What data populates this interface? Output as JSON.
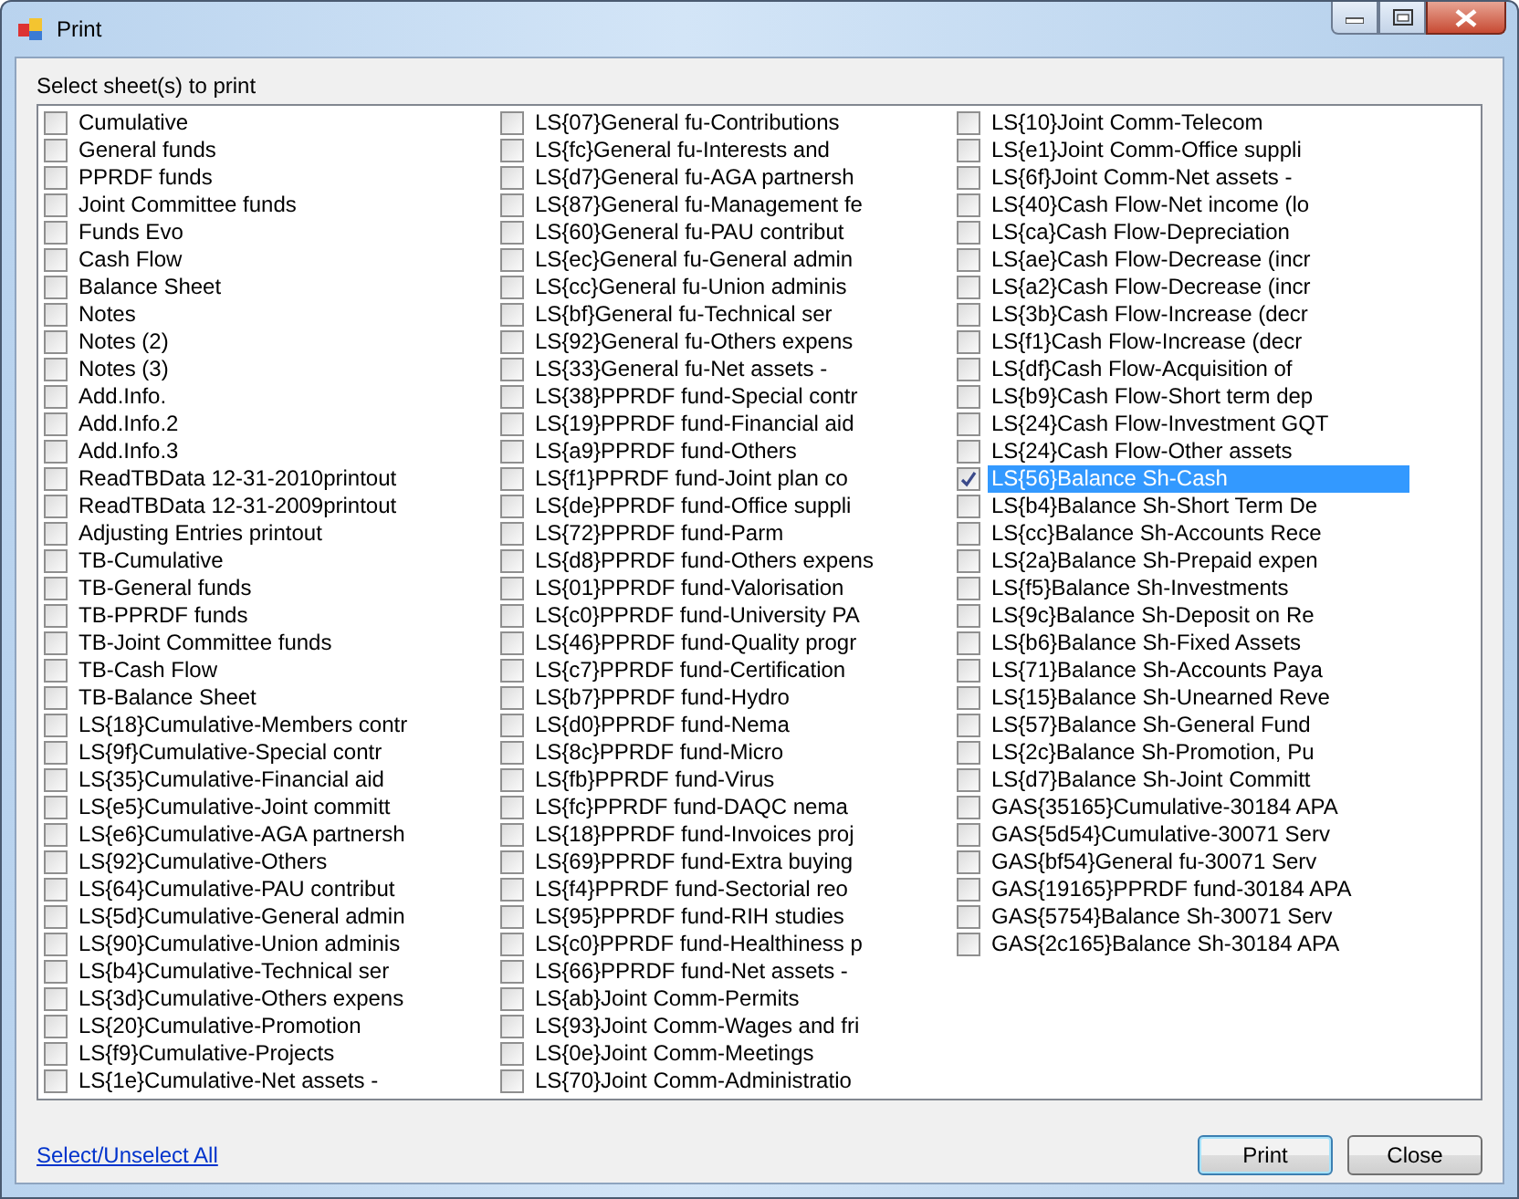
{
  "window": {
    "title": "Print"
  },
  "prompt": "Select sheet(s) to print",
  "sheets": [
    {
      "label": "Cumulative",
      "checked": false,
      "selected": false
    },
    {
      "label": "General funds",
      "checked": false,
      "selected": false
    },
    {
      "label": "PPRDF funds",
      "checked": false,
      "selected": false
    },
    {
      "label": "Joint Committee funds",
      "checked": false,
      "selected": false
    },
    {
      "label": "Funds Evo",
      "checked": false,
      "selected": false
    },
    {
      "label": "Cash Flow",
      "checked": false,
      "selected": false
    },
    {
      "label": "Balance Sheet",
      "checked": false,
      "selected": false
    },
    {
      "label": "Notes",
      "checked": false,
      "selected": false
    },
    {
      "label": "Notes (2)",
      "checked": false,
      "selected": false
    },
    {
      "label": "Notes (3)",
      "checked": false,
      "selected": false
    },
    {
      "label": "Add.Info.",
      "checked": false,
      "selected": false
    },
    {
      "label": "Add.Info.2",
      "checked": false,
      "selected": false
    },
    {
      "label": "Add.Info.3",
      "checked": false,
      "selected": false
    },
    {
      "label": "ReadTBData 12-31-2010printout",
      "checked": false,
      "selected": false
    },
    {
      "label": "ReadTBData 12-31-2009printout",
      "checked": false,
      "selected": false
    },
    {
      "label": "Adjusting Entries printout",
      "checked": false,
      "selected": false
    },
    {
      "label": "TB-Cumulative",
      "checked": false,
      "selected": false
    },
    {
      "label": "TB-General funds",
      "checked": false,
      "selected": false
    },
    {
      "label": "TB-PPRDF funds",
      "checked": false,
      "selected": false
    },
    {
      "label": "TB-Joint Committee funds",
      "checked": false,
      "selected": false
    },
    {
      "label": "TB-Cash Flow",
      "checked": false,
      "selected": false
    },
    {
      "label": "TB-Balance Sheet",
      "checked": false,
      "selected": false
    },
    {
      "label": "LS{18}Cumulative-Members contr",
      "checked": false,
      "selected": false
    },
    {
      "label": "LS{9f}Cumulative-Special contr",
      "checked": false,
      "selected": false
    },
    {
      "label": "LS{35}Cumulative-Financial aid",
      "checked": false,
      "selected": false
    },
    {
      "label": "LS{e5}Cumulative-Joint committ",
      "checked": false,
      "selected": false
    },
    {
      "label": "LS{e6}Cumulative-AGA partnersh",
      "checked": false,
      "selected": false
    },
    {
      "label": "LS{92}Cumulative-Others",
      "checked": false,
      "selected": false
    },
    {
      "label": "LS{64}Cumulative-PAU contribut",
      "checked": false,
      "selected": false
    },
    {
      "label": "LS{5d}Cumulative-General admin",
      "checked": false,
      "selected": false
    },
    {
      "label": "LS{90}Cumulative-Union adminis",
      "checked": false,
      "selected": false
    },
    {
      "label": "LS{b4}Cumulative-Technical ser",
      "checked": false,
      "selected": false
    },
    {
      "label": "LS{3d}Cumulative-Others expens",
      "checked": false,
      "selected": false
    },
    {
      "label": "LS{20}Cumulative-Promotion",
      "checked": false,
      "selected": false
    },
    {
      "label": "LS{f9}Cumulative-Projects",
      "checked": false,
      "selected": false
    },
    {
      "label": "LS{1e}Cumulative-Net assets -",
      "checked": false,
      "selected": false
    },
    {
      "label": "LS{07}General fu-Contributions",
      "checked": false,
      "selected": false
    },
    {
      "label": "LS{fc}General fu-Interests and",
      "checked": false,
      "selected": false
    },
    {
      "label": "LS{d7}General fu-AGA partnersh",
      "checked": false,
      "selected": false
    },
    {
      "label": "LS{87}General fu-Management fe",
      "checked": false,
      "selected": false
    },
    {
      "label": "LS{60}General fu-PAU contribut",
      "checked": false,
      "selected": false
    },
    {
      "label": "LS{ec}General fu-General admin",
      "checked": false,
      "selected": false
    },
    {
      "label": "LS{cc}General fu-Union adminis",
      "checked": false,
      "selected": false
    },
    {
      "label": "LS{bf}General fu-Technical ser",
      "checked": false,
      "selected": false
    },
    {
      "label": "LS{92}General fu-Others expens",
      "checked": false,
      "selected": false
    },
    {
      "label": "LS{33}General fu-Net assets -",
      "checked": false,
      "selected": false
    },
    {
      "label": "LS{38}PPRDF fund-Special contr",
      "checked": false,
      "selected": false
    },
    {
      "label": "LS{19}PPRDF fund-Financial aid",
      "checked": false,
      "selected": false
    },
    {
      "label": "LS{a9}PPRDF fund-Others",
      "checked": false,
      "selected": false
    },
    {
      "label": "LS{f1}PPRDF fund-Joint plan co",
      "checked": false,
      "selected": false
    },
    {
      "label": "LS{de}PPRDF fund-Office suppli",
      "checked": false,
      "selected": false
    },
    {
      "label": "LS{72}PPRDF fund-Parm",
      "checked": false,
      "selected": false
    },
    {
      "label": "LS{d8}PPRDF fund-Others expens",
      "checked": false,
      "selected": false
    },
    {
      "label": "LS{01}PPRDF fund-Valorisation",
      "checked": false,
      "selected": false
    },
    {
      "label": "LS{c0}PPRDF fund-University PA",
      "checked": false,
      "selected": false
    },
    {
      "label": "LS{46}PPRDF fund-Quality progr",
      "checked": false,
      "selected": false
    },
    {
      "label": "LS{c7}PPRDF fund-Certification",
      "checked": false,
      "selected": false
    },
    {
      "label": "LS{b7}PPRDF fund-Hydro",
      "checked": false,
      "selected": false
    },
    {
      "label": "LS{d0}PPRDF fund-Nema",
      "checked": false,
      "selected": false
    },
    {
      "label": "LS{8c}PPRDF fund-Micro",
      "checked": false,
      "selected": false
    },
    {
      "label": "LS{fb}PPRDF fund-Virus",
      "checked": false,
      "selected": false
    },
    {
      "label": "LS{fc}PPRDF fund-DAQC nema",
      "checked": false,
      "selected": false
    },
    {
      "label": "LS{18}PPRDF fund-Invoices proj",
      "checked": false,
      "selected": false
    },
    {
      "label": "LS{69}PPRDF fund-Extra buying",
      "checked": false,
      "selected": false
    },
    {
      "label": "LS{f4}PPRDF fund-Sectorial reo",
      "checked": false,
      "selected": false
    },
    {
      "label": "LS{95}PPRDF fund-RIH studies",
      "checked": false,
      "selected": false
    },
    {
      "label": "LS{c0}PPRDF fund-Healthiness p",
      "checked": false,
      "selected": false
    },
    {
      "label": "LS{66}PPRDF fund-Net assets -",
      "checked": false,
      "selected": false
    },
    {
      "label": "LS{ab}Joint Comm-Permits",
      "checked": false,
      "selected": false
    },
    {
      "label": "LS{93}Joint Comm-Wages and fri",
      "checked": false,
      "selected": false
    },
    {
      "label": "LS{0e}Joint Comm-Meetings",
      "checked": false,
      "selected": false
    },
    {
      "label": "LS{70}Joint Comm-Administratio",
      "checked": false,
      "selected": false
    },
    {
      "label": "LS{10}Joint Comm-Telecom",
      "checked": false,
      "selected": false
    },
    {
      "label": "LS{e1}Joint Comm-Office suppli",
      "checked": false,
      "selected": false
    },
    {
      "label": "LS{6f}Joint Comm-Net assets -",
      "checked": false,
      "selected": false
    },
    {
      "label": "LS{40}Cash Flow-Net income (lo",
      "checked": false,
      "selected": false
    },
    {
      "label": "LS{ca}Cash Flow-Depreciation",
      "checked": false,
      "selected": false
    },
    {
      "label": "LS{ae}Cash Flow-Decrease (incr",
      "checked": false,
      "selected": false
    },
    {
      "label": "LS{a2}Cash Flow-Decrease (incr",
      "checked": false,
      "selected": false
    },
    {
      "label": "LS{3b}Cash Flow-Increase (decr",
      "checked": false,
      "selected": false
    },
    {
      "label": "LS{f1}Cash Flow-Increase (decr",
      "checked": false,
      "selected": false
    },
    {
      "label": "LS{df}Cash Flow-Acquisition of",
      "checked": false,
      "selected": false
    },
    {
      "label": "LS{b9}Cash Flow-Short term dep",
      "checked": false,
      "selected": false
    },
    {
      "label": "LS{24}Cash Flow-Investment GQT",
      "checked": false,
      "selected": false
    },
    {
      "label": "LS{24}Cash Flow-Other assets",
      "checked": false,
      "selected": false
    },
    {
      "label": "LS{56}Balance Sh-Cash",
      "checked": true,
      "selected": true
    },
    {
      "label": "LS{b4}Balance Sh-Short Term De",
      "checked": false,
      "selected": false
    },
    {
      "label": "LS{cc}Balance Sh-Accounts Rece",
      "checked": false,
      "selected": false
    },
    {
      "label": "LS{2a}Balance Sh-Prepaid expen",
      "checked": false,
      "selected": false
    },
    {
      "label": "LS{f5}Balance Sh-Investments",
      "checked": false,
      "selected": false
    },
    {
      "label": "LS{9c}Balance Sh-Deposit on Re",
      "checked": false,
      "selected": false
    },
    {
      "label": "LS{b6}Balance Sh-Fixed Assets",
      "checked": false,
      "selected": false
    },
    {
      "label": "LS{71}Balance Sh-Accounts Paya",
      "checked": false,
      "selected": false
    },
    {
      "label": "LS{15}Balance Sh-Unearned Reve",
      "checked": false,
      "selected": false
    },
    {
      "label": "LS{57}Balance Sh-General Fund",
      "checked": false,
      "selected": false
    },
    {
      "label": "LS{2c}Balance Sh-Promotion, Pu",
      "checked": false,
      "selected": false
    },
    {
      "label": "LS{d7}Balance Sh-Joint Committ",
      "checked": false,
      "selected": false
    },
    {
      "label": "GAS{35165}Cumulative-30184 APA",
      "checked": false,
      "selected": false
    },
    {
      "label": "GAS{5d54}Cumulative-30071 Serv",
      "checked": false,
      "selected": false
    },
    {
      "label": "GAS{bf54}General fu-30071 Serv",
      "checked": false,
      "selected": false
    },
    {
      "label": "GAS{19165}PPRDF fund-30184 APA",
      "checked": false,
      "selected": false
    },
    {
      "label": "GAS{5754}Balance Sh-30071 Serv",
      "checked": false,
      "selected": false
    },
    {
      "label": "GAS{2c165}Balance Sh-30184 APA",
      "checked": false,
      "selected": false
    }
  ],
  "select_all_link": "Select/Unselect All",
  "buttons": [
    {
      "label": "Print",
      "kind": "default"
    },
    {
      "label": "Close",
      "kind": "normal"
    }
  ]
}
